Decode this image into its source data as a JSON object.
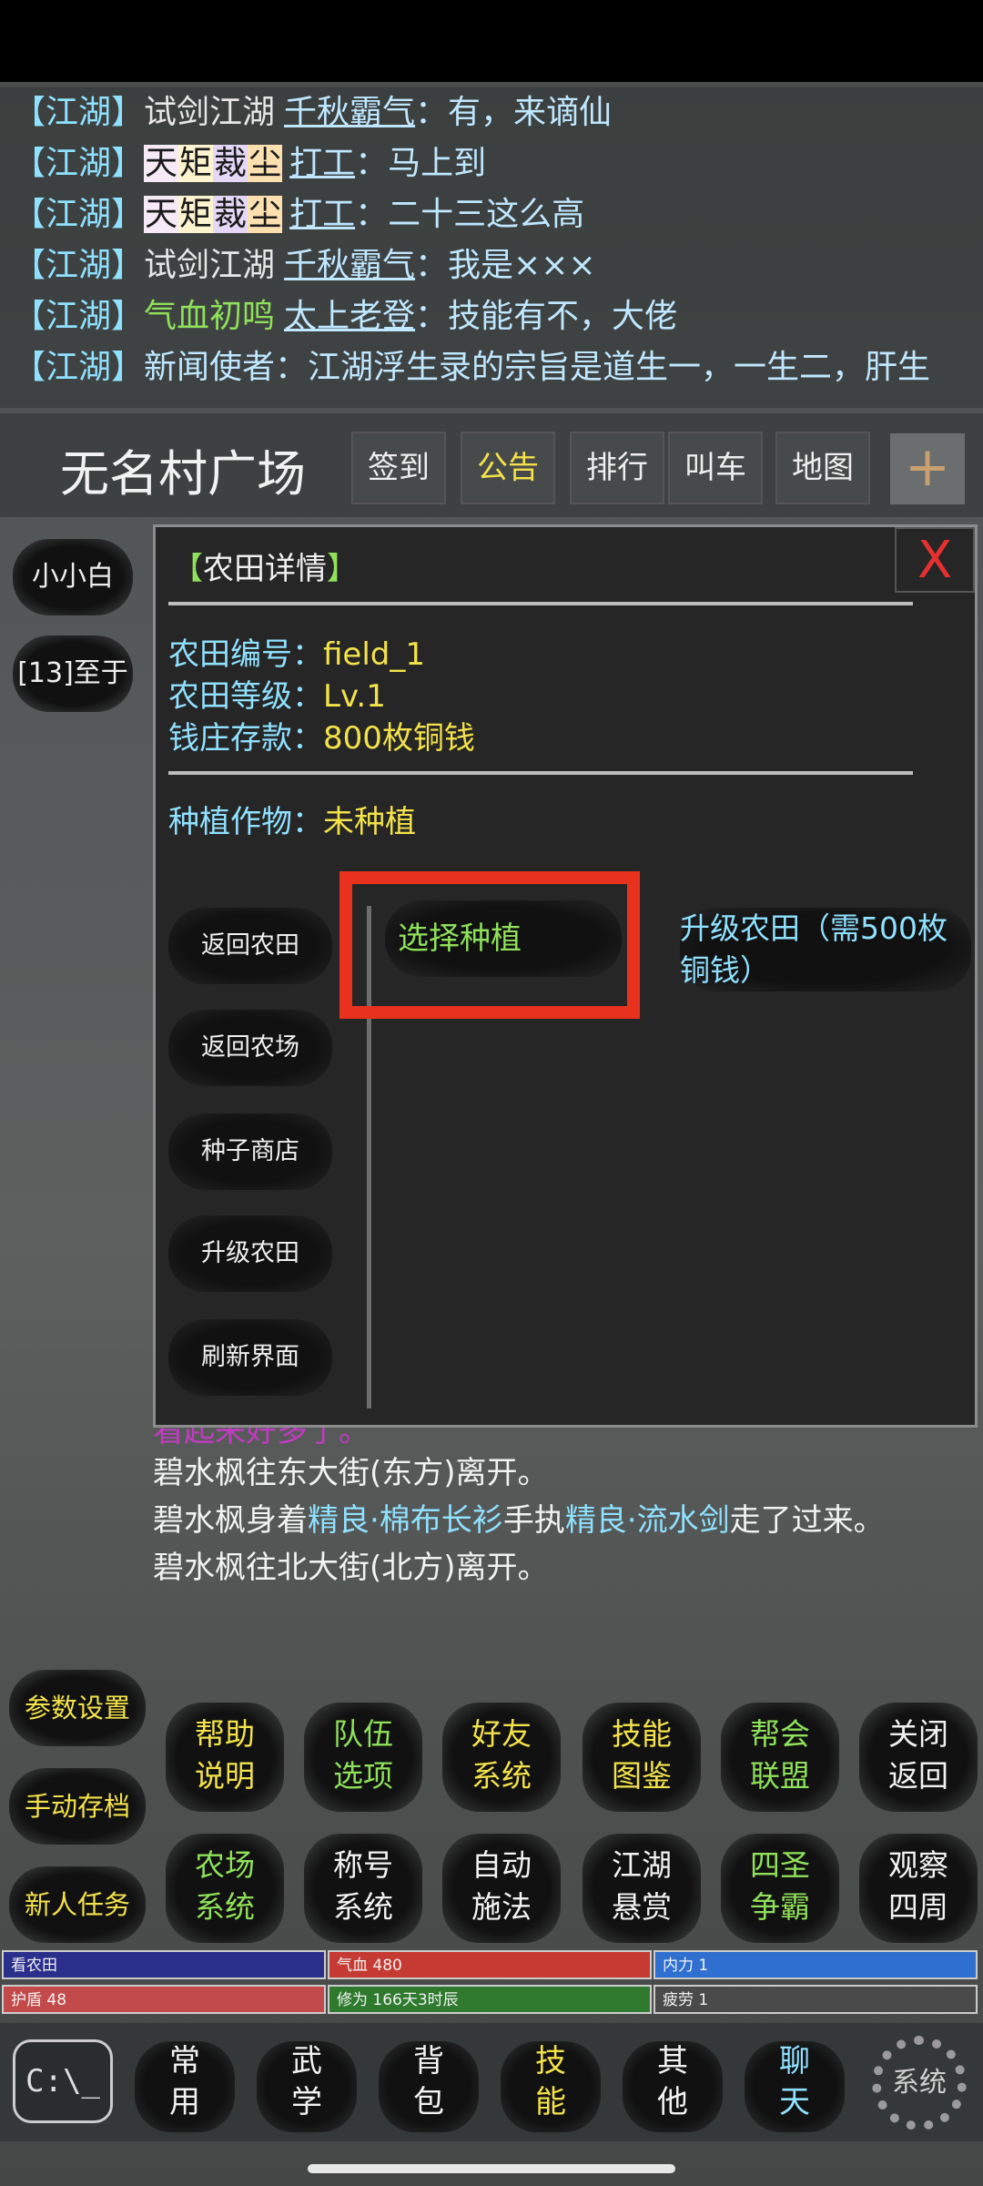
{
  "chat": [
    {
      "channel": "【江湖】",
      "rank": "试剑江湖",
      "rank_style": "plain",
      "user": "千秋霸气",
      "message": "：有，来谪仙"
    },
    {
      "channel": "【江湖】",
      "badge": [
        "天",
        "矩",
        "裁",
        "尘"
      ],
      "user": "打工",
      "message": "：马上到"
    },
    {
      "channel": "【江湖】",
      "badge": [
        "天",
        "矩",
        "裁",
        "尘"
      ],
      "user": "打工",
      "message": "：二十三这么高"
    },
    {
      "channel": "【江湖】",
      "rank": "试剑江湖",
      "rank_style": "plain",
      "user": "千秋霸气",
      "message": "：我是×××"
    },
    {
      "channel": "【江湖】",
      "rank": "气血初鸣",
      "rank_style": "green",
      "user": "太上老登",
      "message": "：技能有不，大佬"
    },
    {
      "channel": "【江湖】",
      "message": "新闻使者：江湖浮生录的宗旨是道生一，一生二，肝生"
    }
  ],
  "location": "无名村广场",
  "top_buttons": [
    {
      "label": "签到",
      "style": "normal"
    },
    {
      "label": "公告",
      "style": "yellow"
    },
    {
      "label": "排行",
      "style": "normal"
    },
    {
      "label": "叫车",
      "style": "normal"
    },
    {
      "label": "地图",
      "style": "normal"
    }
  ],
  "plus_label": "+",
  "side_buttons": [
    "小小白",
    "[13]至于"
  ],
  "dialog": {
    "title_open": "【",
    "title_text": "农田详情",
    "title_close": "】",
    "close_label": "X",
    "field_id_key": "农田编号：",
    "field_id_value": "field_1",
    "level_key": "农田等级：",
    "level_value": "Lv.1",
    "deposit_key": "钱庄存款：",
    "deposit_value": "800枚铜钱",
    "crop_key": "种植作物：",
    "crop_value": "未种植",
    "nav": [
      "返回农田",
      "返回农场",
      "种子商店",
      "升级农田",
      "刷新界面"
    ],
    "choose_plant": "选择种植",
    "upgrade_text": "升级农田（需500枚铜钱）"
  },
  "log": {
    "cut_text": "看起来好多了。",
    "line1": "碧水枫往东大街(东方)离开。",
    "line2_a": "碧水枫身着",
    "line2_item1": "精良·棉布长衫",
    "line2_b": "手执",
    "line2_item2": "精良·流水剑",
    "line2_c": "走了过来。",
    "line3": "碧水枫往北大街(北方)离开。"
  },
  "left_actions": [
    "参数设置",
    "手动存档",
    "新人任务"
  ],
  "grid_row1": [
    {
      "l1": "帮助",
      "l2": "说明",
      "style": "y"
    },
    {
      "l1": "队伍",
      "l2": "选项",
      "style": "g"
    },
    {
      "l1": "好友",
      "l2": "系统",
      "style": "y"
    },
    {
      "l1": "技能",
      "l2": "图鉴",
      "style": "y"
    },
    {
      "l1": "帮会",
      "l2": "联盟",
      "style": "g"
    },
    {
      "l1": "关闭",
      "l2": "返回",
      "style": "w"
    }
  ],
  "grid_row2": [
    {
      "l1": "农场",
      "l2": "系统",
      "style": "g"
    },
    {
      "l1": "称号",
      "l2": "系统",
      "style": "w"
    },
    {
      "l1": "自动",
      "l2": "施法",
      "style": "w"
    },
    {
      "l1": "江湖",
      "l2": "悬赏",
      "style": "w"
    },
    {
      "l1": "四圣",
      "l2": "争霸",
      "style": "g"
    },
    {
      "l1": "观察",
      "l2": "四周",
      "style": "w"
    }
  ],
  "stats": {
    "target": "看农田",
    "hp": "气血 480",
    "mp": "内力 1",
    "shield": "护盾 48",
    "cultivation": "修为 166天3时辰",
    "fatigue": "疲劳 1",
    "colors": {
      "target": "#2b2f8c",
      "hp": "#c53a32",
      "mp": "#2f6fd0",
      "shield": "#c24a4a",
      "cultivation": "#2f7a2f",
      "fatigue": "#4a4a4a"
    }
  },
  "bottom_tabs": [
    {
      "l1": "常",
      "l2": "用",
      "style": "w"
    },
    {
      "l1": "武",
      "l2": "学",
      "style": "w"
    },
    {
      "l1": "背",
      "l2": "包",
      "style": "w"
    },
    {
      "l1": "技",
      "l2": "能",
      "style": "y"
    },
    {
      "l1": "其",
      "l2": "他",
      "style": "w"
    },
    {
      "l1": "聊",
      "l2": "天",
      "style": "c"
    }
  ],
  "cmd_label": "C:\\_",
  "system_label": "系统"
}
